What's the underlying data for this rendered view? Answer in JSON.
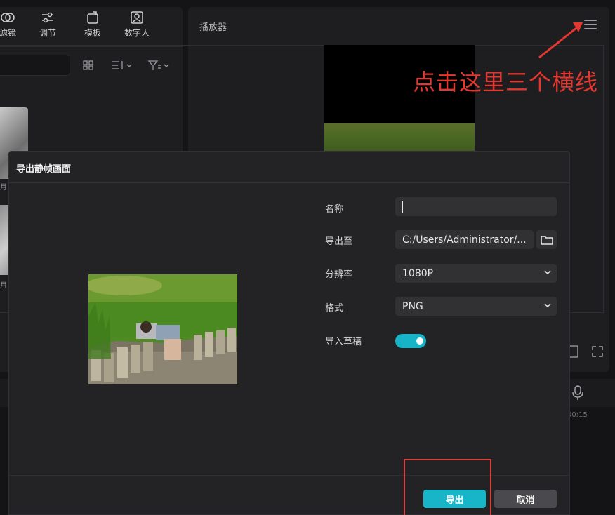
{
  "toolbar": {
    "tabs": [
      {
        "label": "滤镜",
        "icon": "filter-icon"
      },
      {
        "label": "调节",
        "icon": "adjust-icon"
      },
      {
        "label": "模板",
        "icon": "template-icon"
      },
      {
        "label": "数字人",
        "icon": "digital-human-icon"
      }
    ]
  },
  "media": {
    "thumb_labels": [
      "月",
      "月"
    ]
  },
  "player": {
    "title": "播放器",
    "menu_icon": "hamburger-menu-icon"
  },
  "annotation": {
    "text": "点击这里三个横线",
    "color": "#e3372f"
  },
  "timeline": {
    "time_readout": "00:15"
  },
  "dialog": {
    "title": "导出静帧画面",
    "form": {
      "name_label": "名称",
      "name_value": "",
      "export_to_label": "导出至",
      "export_to_value": "C:/Users/Administrator/...",
      "resolution_label": "分辨率",
      "resolution_value": "1080P",
      "format_label": "格式",
      "format_value": "PNG",
      "import_draft_label": "导入草稿",
      "import_draft_on": true
    },
    "buttons": {
      "export": "导出",
      "cancel": "取消"
    },
    "colors": {
      "accent": "#17b5c7",
      "highlight_box": "#d8423b"
    }
  }
}
